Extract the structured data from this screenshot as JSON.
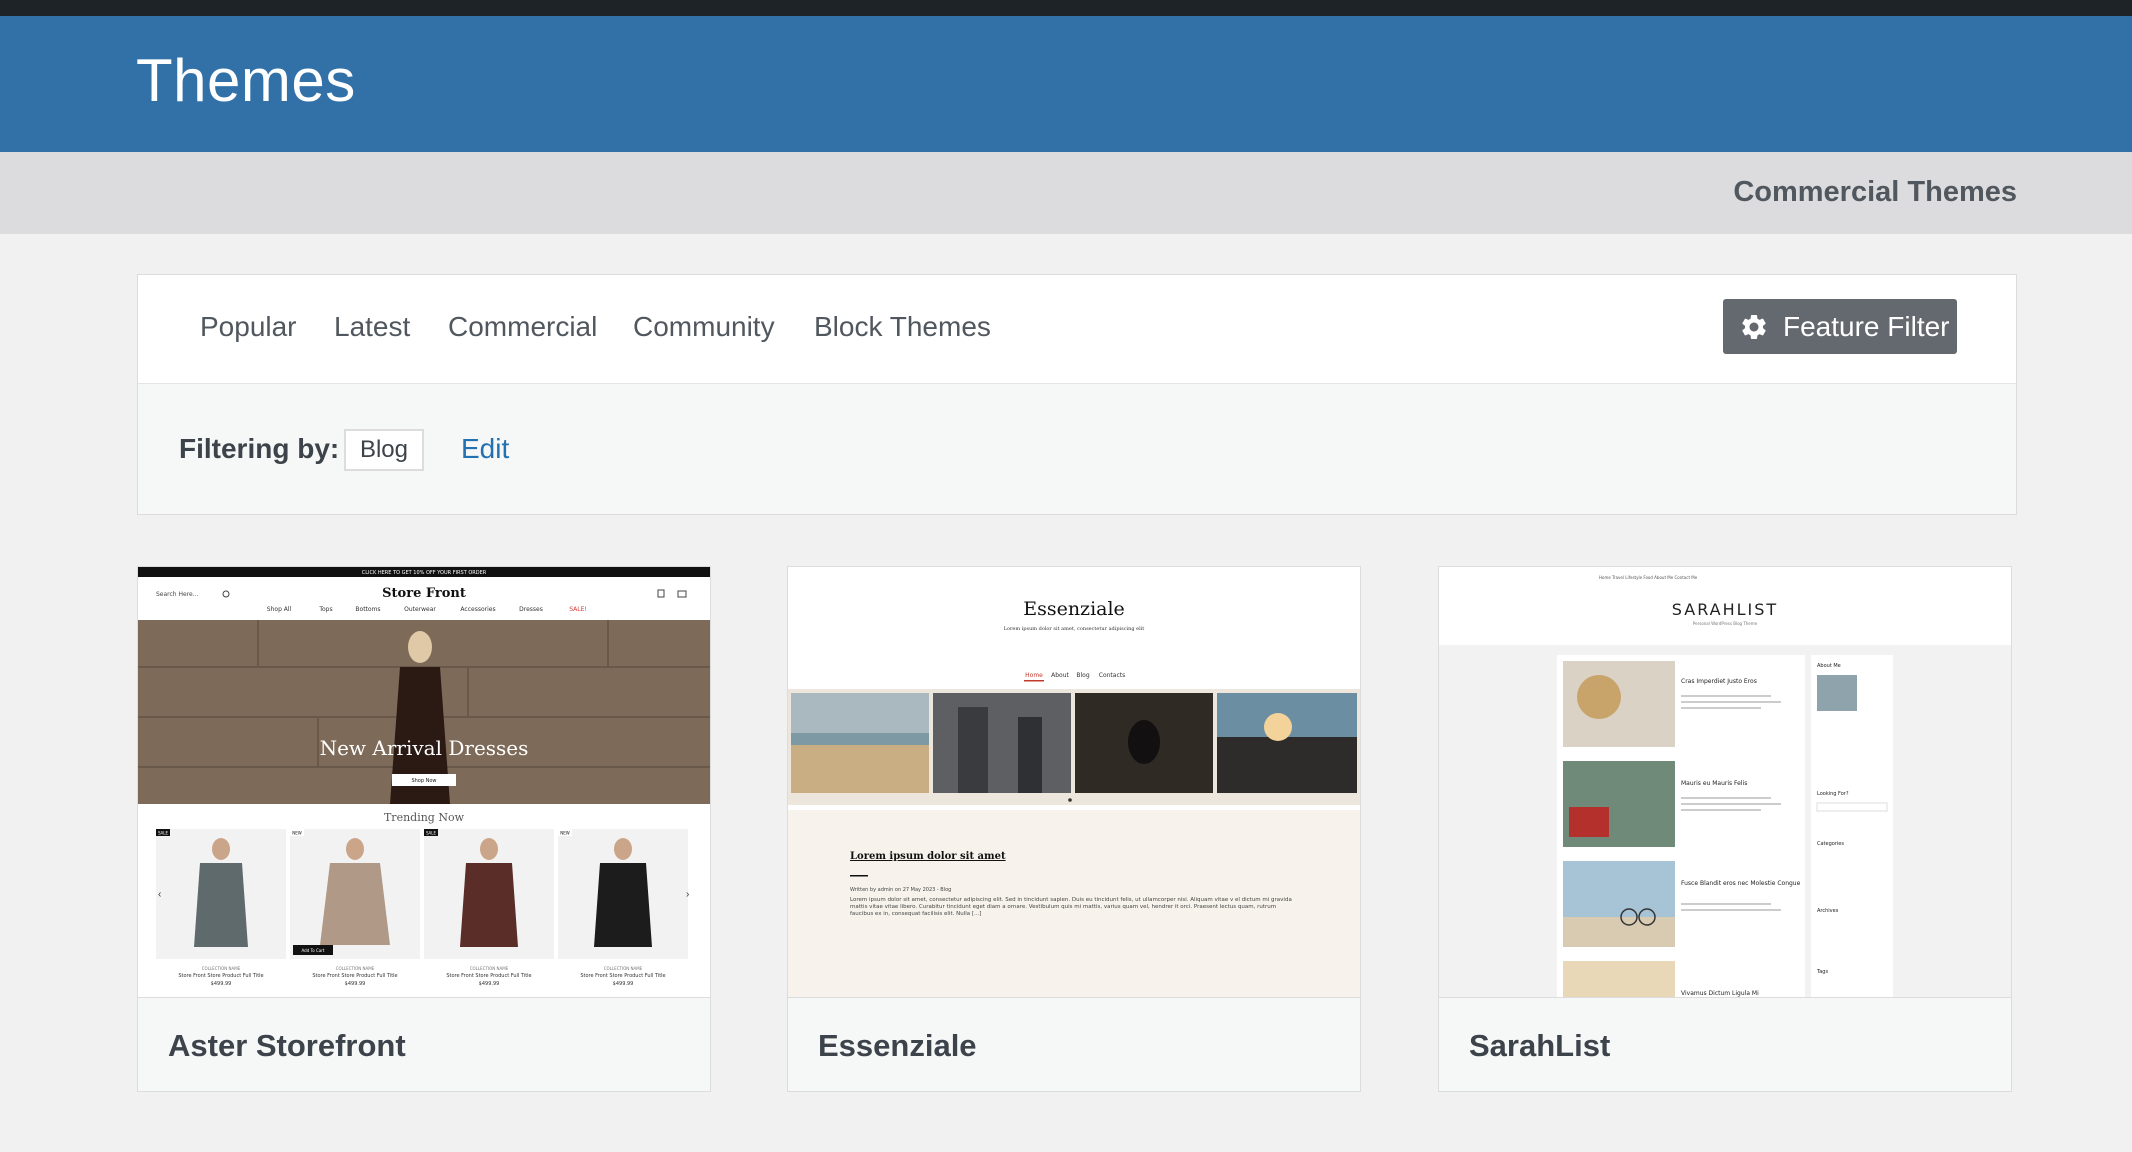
{
  "header": {
    "title": "Themes"
  },
  "subbar": {
    "commercial_link": "Commercial Themes"
  },
  "tabs": [
    {
      "label": "Popular"
    },
    {
      "label": "Latest"
    },
    {
      "label": "Commercial"
    },
    {
      "label": "Community"
    },
    {
      "label": "Block Themes"
    }
  ],
  "feature_filter": {
    "label": "Feature Filter",
    "icon": "gear-icon"
  },
  "filter": {
    "label": "Filtering by:",
    "chip": "Blog",
    "edit": "Edit"
  },
  "themes": [
    {
      "name": "Aster Storefront",
      "preview": {
        "promo": "CLICK HERE TO GET 10% OFF YOUR FIRST ORDER",
        "search": "Search Here...",
        "logo": "Store Front",
        "nav": [
          "Shop All",
          "Tops",
          "Bottoms",
          "Outerwear",
          "Accessories",
          "Dresses",
          "SALE!"
        ],
        "hero": "New Arrival Dresses",
        "hero_button": "Shop Now",
        "section": "Trending Now",
        "products": [
          {
            "badge": "SALE",
            "collection": "COLLECTION NAME",
            "title": "Store Front Store Product Full Title",
            "price": "$499.99"
          },
          {
            "badge": "NEW",
            "collection": "COLLECTION NAME",
            "title": "Store Front Store Product Full Title",
            "price": "$499.99"
          },
          {
            "badge": "SALE",
            "collection": "COLLECTION NAME",
            "title": "Store Front Store Product Full Title",
            "price": "$499.99"
          },
          {
            "badge": "NEW",
            "collection": "COLLECTION NAME",
            "title": "Store Front Store Product Full Title",
            "price": "$499.99"
          }
        ],
        "add_to_cart": "Add To Cart"
      }
    },
    {
      "name": "Essenziale",
      "preview": {
        "site_title": "Essenziale",
        "tagline": "Lorem ipsum dolor sit amet, consectetur adipiscing elit",
        "nav": [
          "Home",
          "About",
          "Blog",
          "Contacts"
        ],
        "post_title": "Lorem ipsum dolor sit amet",
        "meta": "Written by admin on 27 May 2023 - Blog",
        "excerpt": "Lorem ipsum dolor sit amet, consectetur adipiscing elit. Sed in tincidunt sapien. Duis eu tincidunt felis, ut ullamcorper nisi. Aliquam vitae v el dictum mi gravida mattis vitae vitae libero. Curabitur tincidunt eget diam a ornare. Vestibulum quis mi mattis, varius quam vel, hendrer it orci. Praesent lectus quam, rutrum faucibus ex in, consequat facilisis elit. Nulla [...]"
      }
    },
    {
      "name": "SarahList",
      "preview": {
        "top_nav": "Home  Travel  Lifestyle  Food  About Me  Contact Me",
        "site_title": "SARAHLIST",
        "tagline": "Personal WordPress Blog Theme",
        "posts": [
          "Cras Imperdiet Justo Eros",
          "Mauris eu Mauris Felis",
          "Fusce Blandit eros nec Molestie Congue",
          "Vivamus Dictum Ligula Mi"
        ],
        "sidebar": [
          "About Me",
          "Looking For?",
          "Categories",
          "Archives",
          "Tags"
        ]
      }
    }
  ]
}
